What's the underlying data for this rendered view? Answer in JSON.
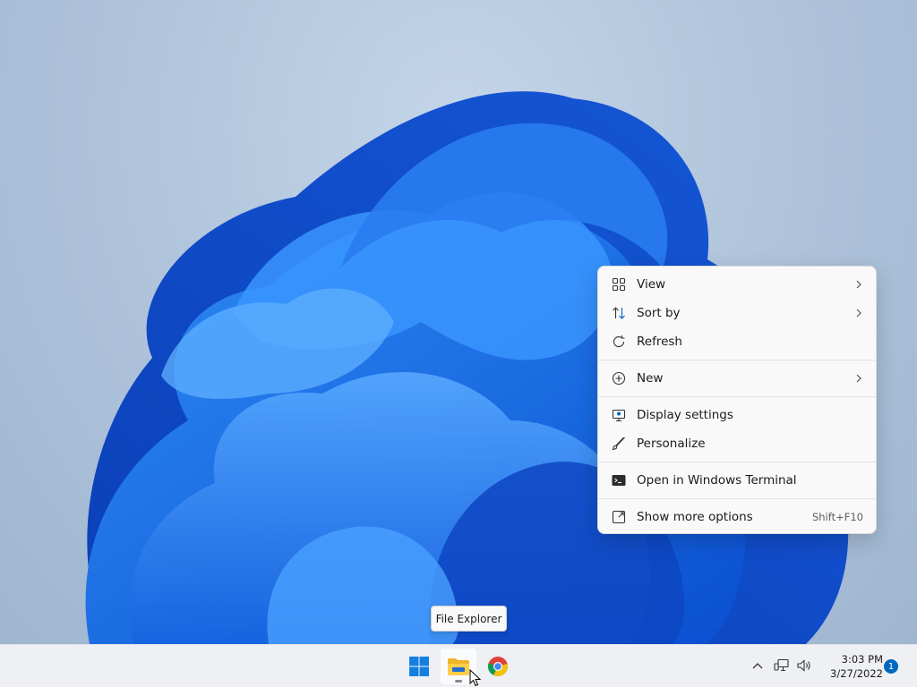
{
  "context_menu": {
    "items": [
      {
        "label": "View",
        "icon": "grid-icon",
        "submenu": true
      },
      {
        "label": "Sort by",
        "icon": "sort-icon",
        "submenu": true
      },
      {
        "label": "Refresh",
        "icon": "refresh-icon",
        "submenu": false
      },
      {
        "label": "New",
        "icon": "plus-circle-icon",
        "submenu": true
      },
      {
        "label": "Display settings",
        "icon": "monitor-icon",
        "submenu": false
      },
      {
        "label": "Personalize",
        "icon": "brush-icon",
        "submenu": false
      },
      {
        "label": "Open in Windows Terminal",
        "icon": "terminal-icon",
        "submenu": false
      },
      {
        "label": "Show more options",
        "icon": "external-icon",
        "shortcut": "Shift+F10"
      }
    ]
  },
  "tooltip": {
    "text": "File Explorer"
  },
  "taskbar": {
    "apps": [
      {
        "name": "Start",
        "icon": "windows-logo-icon"
      },
      {
        "name": "File Explorer",
        "icon": "folder-icon",
        "active": true
      },
      {
        "name": "Google Chrome",
        "icon": "chrome-icon"
      }
    ],
    "tray": {
      "time": "3:03 PM",
      "date": "3/27/2022",
      "notification_count": "1"
    }
  },
  "colors": {
    "accent": "#0067c0",
    "bloom": "#1a6fe8",
    "menu_bg": "#f9f9f9"
  }
}
